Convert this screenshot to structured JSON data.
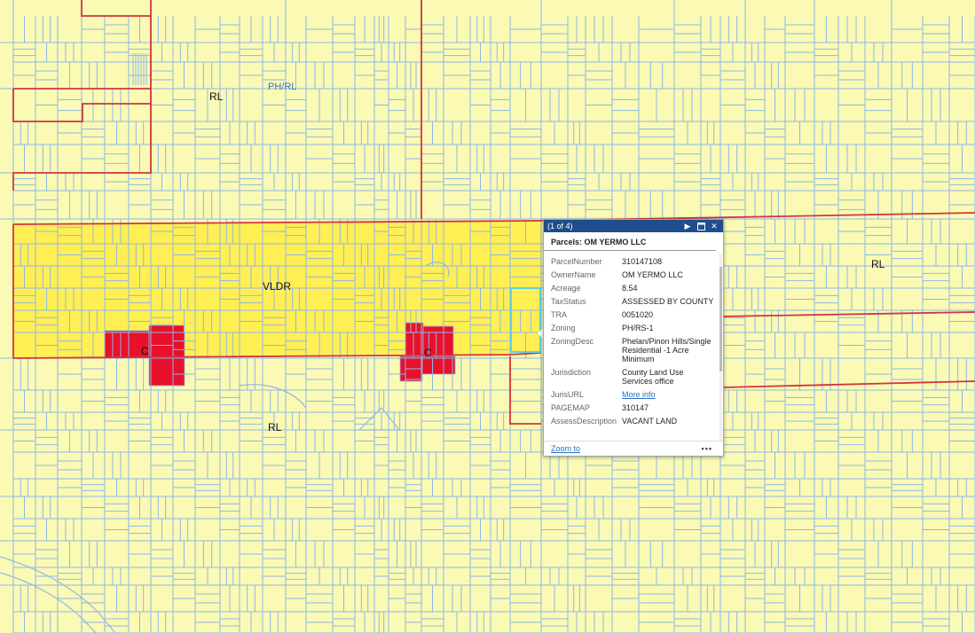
{
  "map": {
    "zone_labels": [
      {
        "id": "zone-rl-1",
        "text": "RL"
      },
      {
        "id": "zone-phrl",
        "text": "PH/RL"
      },
      {
        "id": "zone-vldr",
        "text": "VLDR"
      },
      {
        "id": "zone-c-1",
        "text": "C"
      },
      {
        "id": "zone-c-2",
        "text": "C"
      },
      {
        "id": "zone-rl-2",
        "text": "RL"
      },
      {
        "id": "zone-rl-3",
        "text": "RL"
      }
    ],
    "colors": {
      "background": "#fafab4",
      "parcel_line": "#8fb7e6",
      "zone_line": "#d2343f",
      "vldr_fill": "#ffef55",
      "commercial_fill": "#e8102a"
    }
  },
  "popup": {
    "counter": "(1 of 4)",
    "title": "Parcels: OM YERMO LLC",
    "fields": [
      {
        "key": "ParcelNumber",
        "value": "310147108"
      },
      {
        "key": "OwnerName",
        "value": "OM YERMO LLC"
      },
      {
        "key": "Acreage",
        "value": "8.54"
      },
      {
        "key": "TaxStatus",
        "value": "ASSESSED BY COUNTY"
      },
      {
        "key": "TRA",
        "value": "0051020"
      },
      {
        "key": "Zoning",
        "value": "PH/RS-1"
      },
      {
        "key": "ZoningDesc",
        "value": "Phelan/Pinon Hills/Single Residential -1 Acre Minimum"
      },
      {
        "key": "Jurisdiction",
        "value": "County Land Use Services office"
      },
      {
        "key": "JurisURL",
        "value": "More info",
        "link": true
      },
      {
        "key": "PAGEMAP",
        "value": "310147"
      },
      {
        "key": "AssessDescription",
        "value": "VACANT LAND"
      }
    ],
    "zoom_label": "Zoom to",
    "more_label": "•••",
    "icons": {
      "next": "play-icon",
      "maximize": "maximize-icon",
      "close": "close-icon"
    }
  }
}
